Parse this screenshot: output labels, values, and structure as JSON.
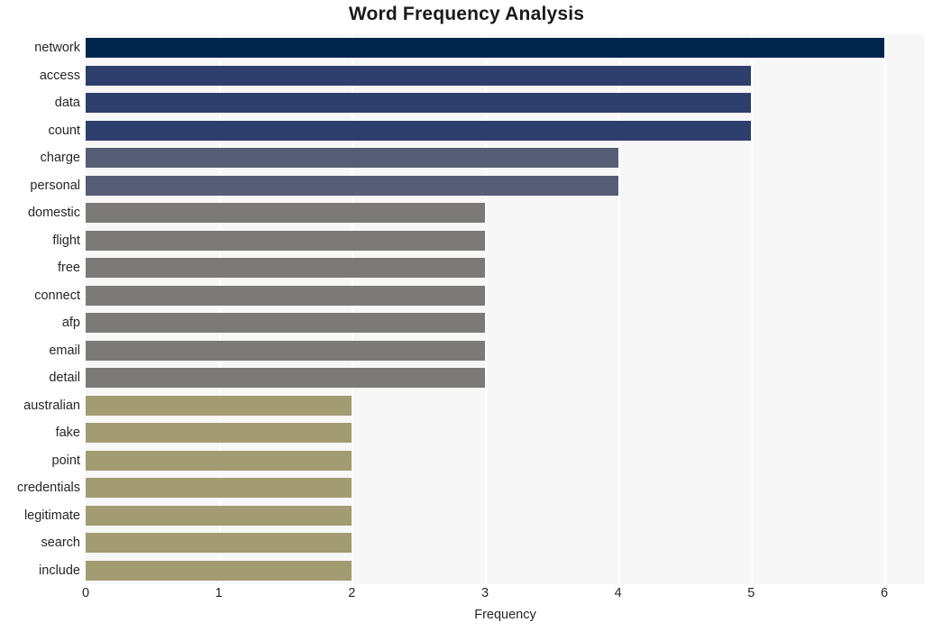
{
  "chart_data": {
    "type": "bar",
    "orientation": "horizontal",
    "title": "Word Frequency Analysis",
    "xlabel": "Frequency",
    "ylabel": "",
    "xlim": [
      0,
      6
    ],
    "xticks": [
      0,
      1,
      2,
      3,
      4,
      5,
      6
    ],
    "xtick_labels": [
      "0",
      "1",
      "2",
      "3",
      "4",
      "5",
      "6"
    ],
    "grid": "vertical",
    "legend": "none",
    "categories": [
      "network",
      "access",
      "data",
      "count",
      "charge",
      "personal",
      "domestic",
      "flight",
      "free",
      "connect",
      "afp",
      "email",
      "detail",
      "australian",
      "fake",
      "point",
      "credentials",
      "legitimate",
      "search",
      "include"
    ],
    "values": [
      6,
      5,
      5,
      5,
      4,
      4,
      3,
      3,
      3,
      3,
      3,
      3,
      3,
      2,
      2,
      2,
      2,
      2,
      2,
      2
    ],
    "bar_colors": [
      "#00254d",
      "#2e3f6d",
      "#2e3f6d",
      "#2e3f6d",
      "#565e75",
      "#565e75",
      "#7b7a76",
      "#7b7a76",
      "#7b7a76",
      "#7b7a76",
      "#7b7a76",
      "#7b7a76",
      "#7b7a76",
      "#a39b72",
      "#a39b72",
      "#a39b72",
      "#a39b72",
      "#a39b72",
      "#a39b72",
      "#a39b72"
    ],
    "bars": [
      {
        "label": "network",
        "value": 6,
        "color": "#00254d"
      },
      {
        "label": "access",
        "value": 5,
        "color": "#2e3f6d"
      },
      {
        "label": "data",
        "value": 5,
        "color": "#2e3f6d"
      },
      {
        "label": "count",
        "value": 5,
        "color": "#2e3f6d"
      },
      {
        "label": "charge",
        "value": 4,
        "color": "#565e75"
      },
      {
        "label": "personal",
        "value": 4,
        "color": "#565e75"
      },
      {
        "label": "domestic",
        "value": 3,
        "color": "#7b7a76"
      },
      {
        "label": "flight",
        "value": 3,
        "color": "#7b7a76"
      },
      {
        "label": "free",
        "value": 3,
        "color": "#7b7a76"
      },
      {
        "label": "connect",
        "value": 3,
        "color": "#7b7a76"
      },
      {
        "label": "afp",
        "value": 3,
        "color": "#7b7a76"
      },
      {
        "label": "email",
        "value": 3,
        "color": "#7b7a76"
      },
      {
        "label": "detail",
        "value": 3,
        "color": "#7b7a76"
      },
      {
        "label": "australian",
        "value": 2,
        "color": "#a39b72"
      },
      {
        "label": "fake",
        "value": 2,
        "color": "#a39b72"
      },
      {
        "label": "point",
        "value": 2,
        "color": "#a39b72"
      },
      {
        "label": "credentials",
        "value": 2,
        "color": "#a39b72"
      },
      {
        "label": "legitimate",
        "value": 2,
        "color": "#a39b72"
      },
      {
        "label": "search",
        "value": 2,
        "color": "#a39b72"
      },
      {
        "label": "include",
        "value": 2,
        "color": "#a39b72"
      }
    ],
    "plot_background": "#f7f7f7",
    "grid_color": "#ffffff",
    "figure_background": "#ffffff"
  }
}
